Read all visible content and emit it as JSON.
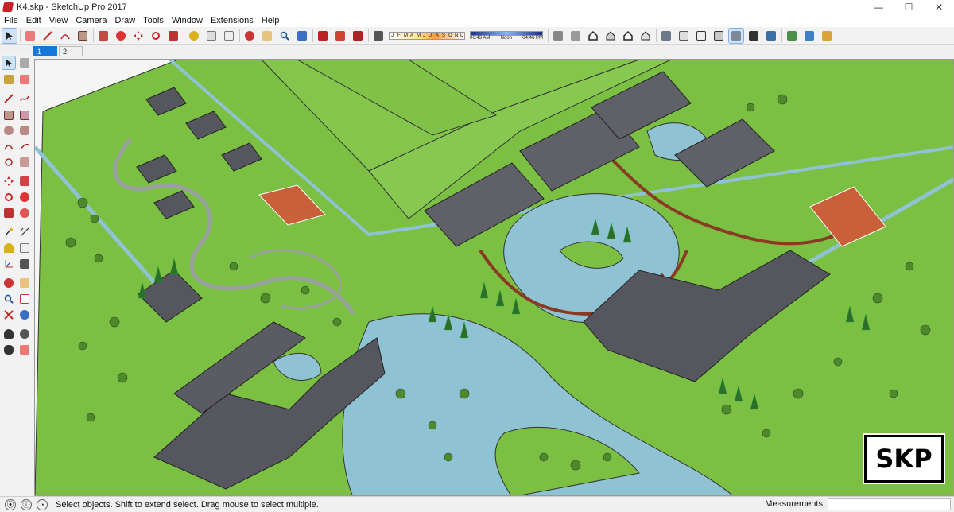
{
  "window": {
    "title": "K4.skp - SketchUp Pro 2017",
    "controls": {
      "minimize": "—",
      "maximize": "☐",
      "close": "✕"
    }
  },
  "menu": [
    "File",
    "Edit",
    "View",
    "Camera",
    "Draw",
    "Tools",
    "Window",
    "Extensions",
    "Help"
  ],
  "shadows": {
    "months": [
      "J",
      "F",
      "M",
      "A",
      "M",
      "J",
      "J",
      "A",
      "S",
      "O",
      "N",
      "D"
    ],
    "time_start": "06:43 AM",
    "time_mid": "Noon",
    "time_end": "04:46 PM"
  },
  "scenes": {
    "tabs": [
      "1",
      "2"
    ],
    "active": "1"
  },
  "badge": {
    "text": "SKP"
  },
  "status": {
    "message": "Select objects. Shift to extend select. Drag mouse to select multiple.",
    "measurements_label": "Measurements",
    "measurements_value": ""
  },
  "colors": {
    "grass": "#7bc043",
    "grass_dark": "#5fa030",
    "water": "#8fc3d4",
    "roof": "#5f6068",
    "path": "#8a3a22",
    "court": "#c9603a"
  }
}
